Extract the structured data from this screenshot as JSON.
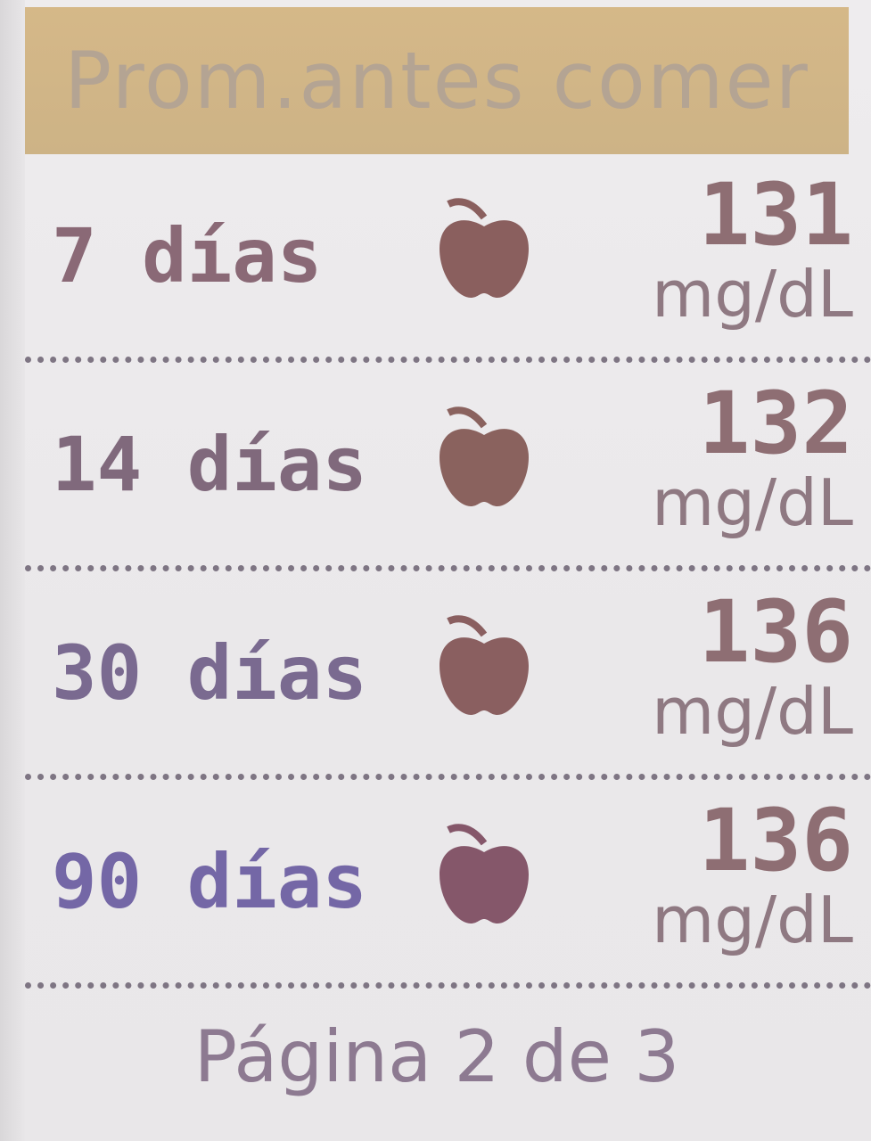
{
  "header": {
    "title": "Prom.antes comer"
  },
  "rows": [
    {
      "period": "7 días",
      "icon": "apple-icon",
      "value": "131",
      "unit": "mg/dL"
    },
    {
      "period": "14 días",
      "icon": "apple-icon",
      "value": "132",
      "unit": "mg/dL"
    },
    {
      "period": "30 días",
      "icon": "apple-icon",
      "value": "136",
      "unit": "mg/dL"
    },
    {
      "period": "90 días",
      "icon": "apple-icon",
      "value": "136",
      "unit": "mg/dL"
    }
  ],
  "footer": {
    "page_label": "Página 2 de 3"
  },
  "colors": {
    "header_bg": "#d5b888",
    "screen_bg": "#eeecee",
    "apple": "#8a5f5e",
    "divider": "#7e7583"
  }
}
